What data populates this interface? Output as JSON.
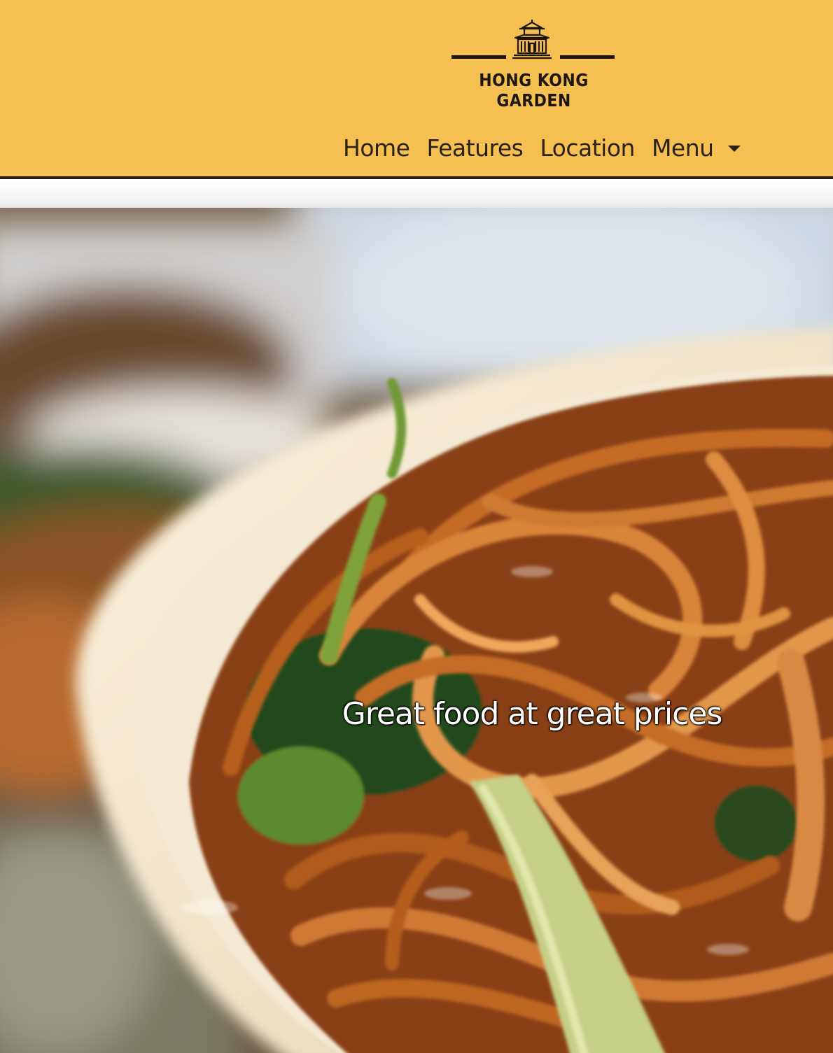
{
  "header": {
    "brand_name": "HONG KONG GARDEN",
    "logo_icon": "temple-icon",
    "background_color": "#f6bf52",
    "border_color": "#2a1d10"
  },
  "nav": {
    "items": [
      {
        "label": "Home"
      },
      {
        "label": "Features"
      },
      {
        "label": "Location"
      }
    ],
    "dropdown": {
      "label": "Menu",
      "icon": "caret-down-icon"
    }
  },
  "hero": {
    "caption": "Great food at great prices",
    "image_subject": "noodles-photo"
  }
}
